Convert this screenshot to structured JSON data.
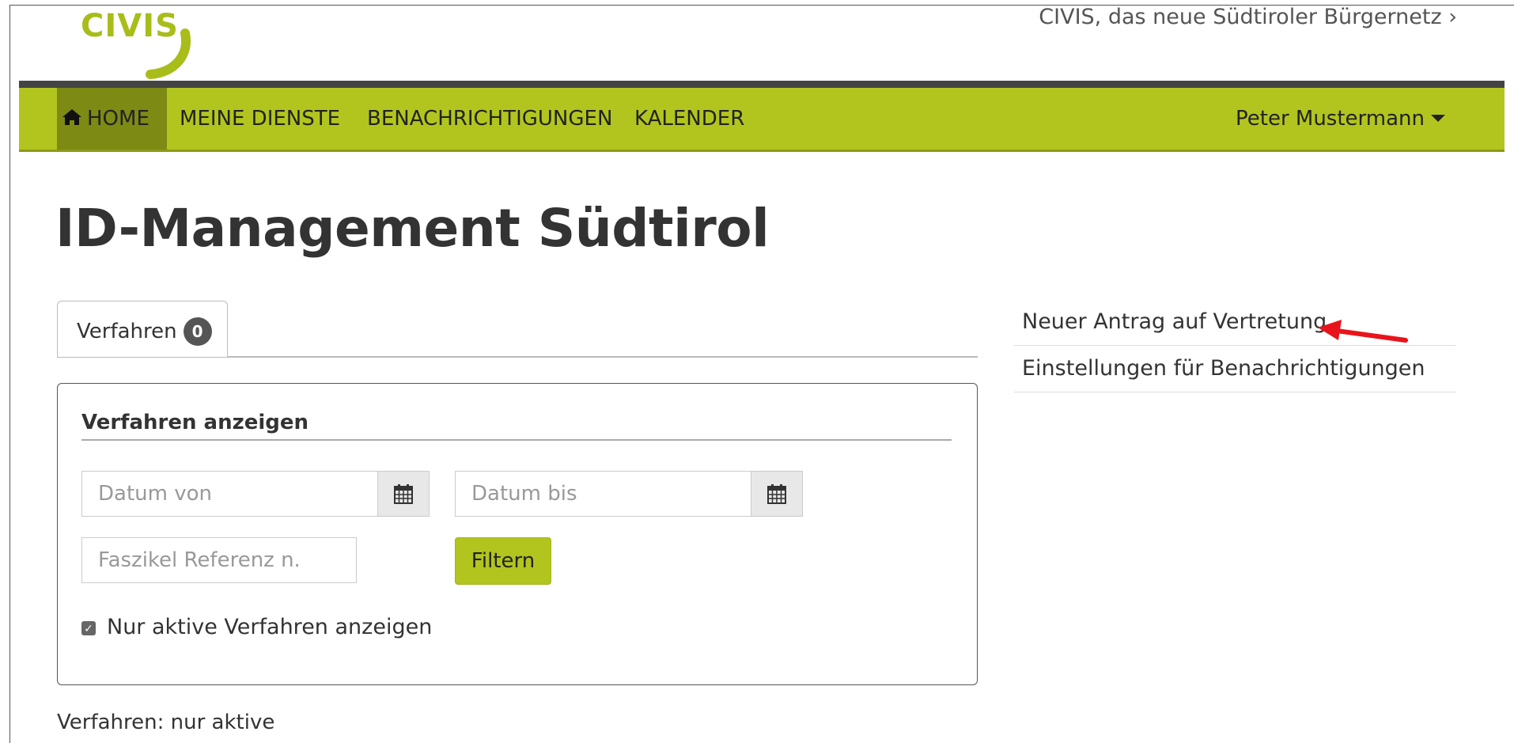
{
  "header": {
    "logo_text": "CIVIS",
    "portal_link": "CIVIS, das neue Südtiroler Bürgernetz ›",
    "brand_color": "#b2c51f"
  },
  "nav": {
    "items": [
      {
        "label": "HOME",
        "icon": "home-icon",
        "active": true
      },
      {
        "label": "MEINE DIENSTE"
      },
      {
        "label": "BENACHRICHTIGUNGEN"
      },
      {
        "label": "KALENDER"
      }
    ],
    "user": "Peter Mustermann"
  },
  "page": {
    "title": "ID-Management Südtirol"
  },
  "tabs": [
    {
      "label": "Verfahren",
      "badge": "0"
    }
  ],
  "filter": {
    "title": "Verfahren anzeigen",
    "date_from_placeholder": "Datum von",
    "date_to_placeholder": "Datum bis",
    "reference_placeholder": "Faszikel Referenz n.",
    "filter_button": "Filtern",
    "active_only_label": "Nur aktive Verfahren anzeigen",
    "active_only_checked": true
  },
  "status_text": "Verfahren: nur aktive",
  "side_links": [
    {
      "label": "Neuer Antrag auf Vertretung"
    },
    {
      "label": "Einstellungen für Benachrichtigungen"
    }
  ],
  "annotation": {
    "arrow_color": "#e8141b"
  }
}
